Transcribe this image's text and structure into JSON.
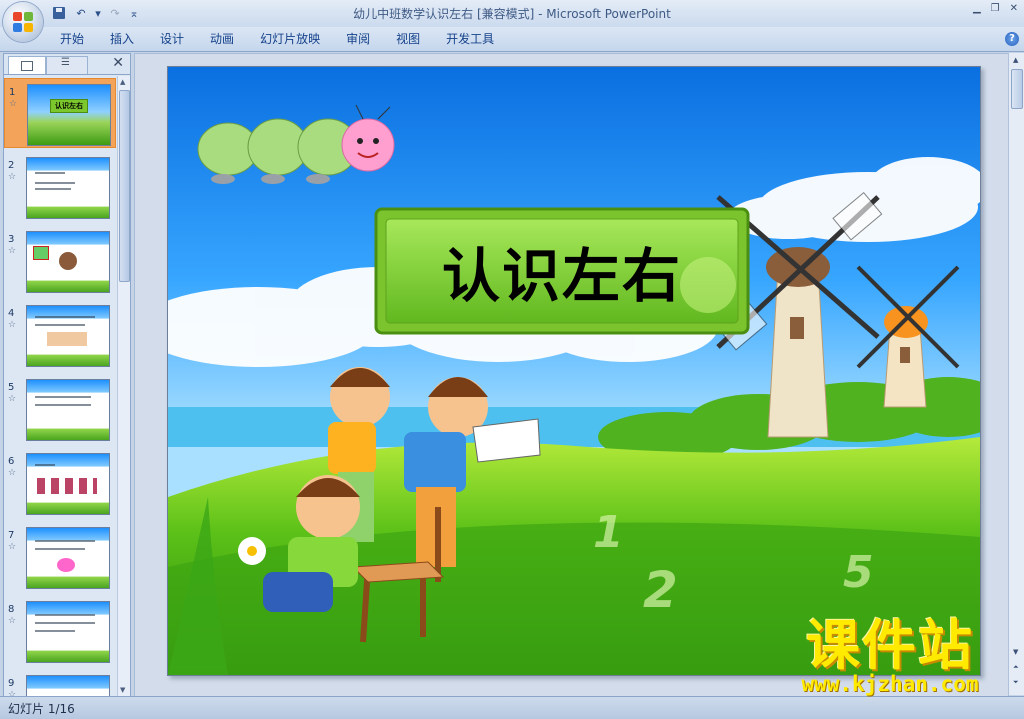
{
  "window": {
    "title": "幼儿中班数学认识左右 [兼容模式] - Microsoft PowerPoint",
    "minimize": "▁",
    "restore": "❐",
    "close": "✕"
  },
  "qat": {
    "undo": "↶",
    "dropdown": "▾",
    "redo": "↷",
    "customize": "⌅"
  },
  "ribbon": {
    "tabs": [
      "开始",
      "插入",
      "设计",
      "动画",
      "幻灯片放映",
      "审阅",
      "视图",
      "开发工具"
    ],
    "help": "?"
  },
  "side_panel": {
    "close": "✕",
    "outline_tab_icon": "☰",
    "thumbnails": [
      {
        "number": "1",
        "star": "☆",
        "selected": true
      },
      {
        "number": "2",
        "star": "☆",
        "selected": false
      },
      {
        "number": "3",
        "star": "☆",
        "selected": false
      },
      {
        "number": "4",
        "star": "☆",
        "selected": false
      },
      {
        "number": "5",
        "star": "☆",
        "selected": false
      },
      {
        "number": "6",
        "star": "☆",
        "selected": false
      },
      {
        "number": "7",
        "star": "☆",
        "selected": false
      },
      {
        "number": "8",
        "star": "☆",
        "selected": false
      },
      {
        "number": "9",
        "star": "☆",
        "selected": false
      }
    ],
    "thumb1_label": "认识左右"
  },
  "slide": {
    "title": "认识左右",
    "numbers": [
      "1",
      "2",
      "5"
    ]
  },
  "watermark": {
    "logo": "课件站",
    "url": "www.kjzhan.com"
  },
  "status": {
    "slide_indicator": "幻灯片 1/16"
  },
  "icons": [
    "office-button-icon",
    "save-icon",
    "undo-icon",
    "redo-icon",
    "help-icon",
    "close-icon",
    "star-icon",
    "windmill",
    "caterpillar"
  ]
}
